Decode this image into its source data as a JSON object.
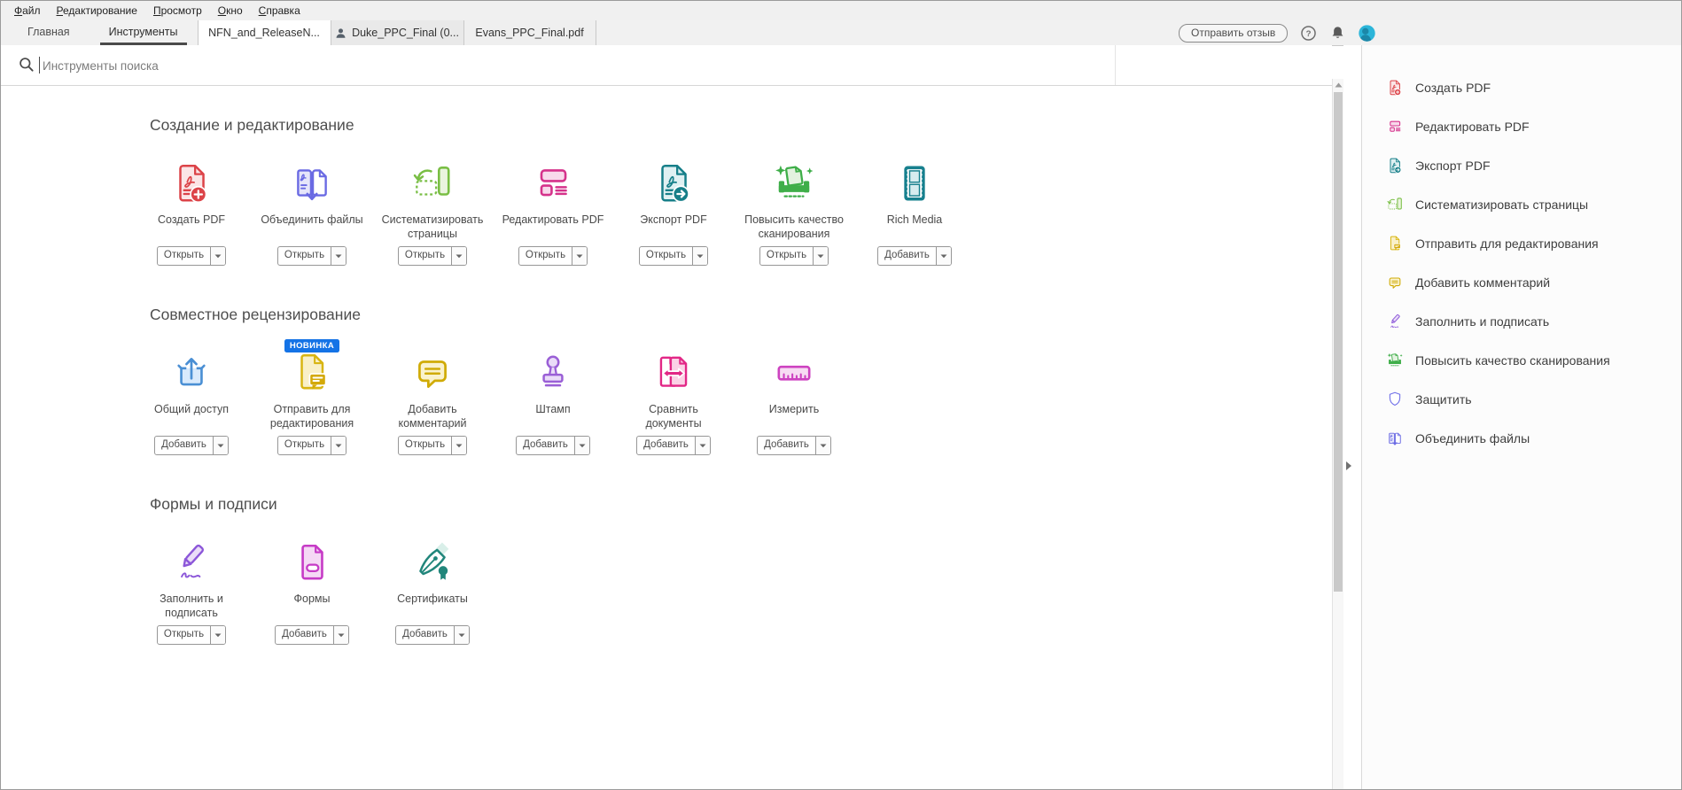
{
  "menu_bar": {
    "items": [
      "Файл",
      "Редактирование",
      "Просмотр",
      "Окно",
      "Справка"
    ]
  },
  "tab_bar": {
    "nav_tabs": [
      {
        "label": "Главная",
        "active": false
      },
      {
        "label": "Инструменты",
        "active": true
      }
    ],
    "doc_tabs": [
      {
        "label": "NFN_and_ReleaseN...",
        "has_user_icon": false
      },
      {
        "label": "Duke_PPC_Final (0...",
        "has_user_icon": true
      },
      {
        "label": "Evans_PPC_Final.pdf",
        "has_user_icon": false
      }
    ],
    "feedback_button": "Отправить отзыв"
  },
  "search": {
    "placeholder": "Инструменты поиска"
  },
  "sections": [
    {
      "title": "Создание и редактирование",
      "tools": [
        {
          "label": "Создать PDF",
          "button": "Открыть",
          "icon": "create-pdf"
        },
        {
          "label": "Объединить файлы",
          "button": "Открыть",
          "icon": "combine-files"
        },
        {
          "label": "Систематизировать страницы",
          "button": "Открыть",
          "icon": "organize-pages"
        },
        {
          "label": "Редактировать PDF",
          "button": "Открыть",
          "icon": "edit-pdf"
        },
        {
          "label": "Экспорт PDF",
          "button": "Открыть",
          "icon": "export-pdf"
        },
        {
          "label": "Повысить качество сканирования",
          "button": "Открыть",
          "icon": "enhance-scans"
        },
        {
          "label": "Rich Media",
          "button": "Добавить",
          "icon": "rich-media"
        }
      ]
    },
    {
      "title": "Совместное рецензирование",
      "tools": [
        {
          "label": "Общий доступ",
          "button": "Добавить",
          "icon": "share"
        },
        {
          "label": "Отправить для редактирования",
          "button": "Открыть",
          "icon": "send-review",
          "badge": "НОВИНКА"
        },
        {
          "label": "Добавить комментарий",
          "button": "Открыть",
          "icon": "add-comment"
        },
        {
          "label": "Штамп",
          "button": "Добавить",
          "icon": "stamp"
        },
        {
          "label": "Сравнить документы",
          "button": "Добавить",
          "icon": "compare-docs"
        },
        {
          "label": "Измерить",
          "button": "Добавить",
          "icon": "measure"
        }
      ]
    },
    {
      "title": "Формы и подписи",
      "tools": [
        {
          "label": "Заполнить и подписать",
          "button": "Открыть",
          "icon": "fill-sign"
        },
        {
          "label": "Формы",
          "button": "Добавить",
          "icon": "forms"
        },
        {
          "label": "Сертификаты",
          "button": "Добавить",
          "icon": "certificates"
        }
      ]
    }
  ],
  "right_panel": {
    "items": [
      {
        "label": "Создать PDF",
        "icon": "create-pdf"
      },
      {
        "label": "Редактировать PDF",
        "icon": "edit-pdf"
      },
      {
        "label": "Экспорт PDF",
        "icon": "export-pdf"
      },
      {
        "label": "Систематизировать страницы",
        "icon": "organize-pages"
      },
      {
        "label": "Отправить для редактирования",
        "icon": "send-review"
      },
      {
        "label": "Добавить комментарий",
        "icon": "add-comment"
      },
      {
        "label": "Заполнить и подписать",
        "icon": "fill-sign"
      },
      {
        "label": "Повысить качество сканирования",
        "icon": "enhance-scans"
      },
      {
        "label": "Защитить",
        "icon": "protect"
      },
      {
        "label": "Объединить файлы",
        "icon": "combine-files"
      }
    ]
  },
  "palette": {
    "create-pdf": [
      "#DC4348",
      "#FBE5E6"
    ],
    "combine-files": [
      "#6A6AE3",
      "#E6E6FA"
    ],
    "organize-pages": [
      "#79BE44",
      "#EAF4DF"
    ],
    "edit-pdf": [
      "#D5328B",
      "#F8D9EB"
    ],
    "export-pdf": [
      "#177F89",
      "#DFF0F2"
    ],
    "enhance-scans": [
      "#3FAE49",
      "#E3F2E0"
    ],
    "rich-media": [
      "#17808E",
      "#D7ECEF"
    ],
    "share": [
      "#4A8FD4",
      "#D9EAFC"
    ],
    "send-review": [
      "#D8B513",
      "#F9F0C8",
      "#D4A908"
    ],
    "add-comment": [
      "#D0AB06",
      "#FAF2CD"
    ],
    "stamp": [
      "#9A5FD6",
      "#EADCF8"
    ],
    "compare-docs": [
      "#E22786",
      "#FBD2E6"
    ],
    "measure": [
      "#CD42C0",
      "#F7DBF3"
    ],
    "fill-sign": [
      "#8C57D9",
      "#EADDF8"
    ],
    "forms": [
      "#C63BC6",
      "#F5D9F5"
    ],
    "certificates": [
      "#21867B",
      "#D9EFE9"
    ],
    "protect": [
      "#6F6FE8",
      "#FFFFFF"
    ]
  },
  "ui_colors": {
    "badge": "#1473E6",
    "active_tab_underline": "#4A4A4A",
    "avatar": "#2CB5D9"
  }
}
